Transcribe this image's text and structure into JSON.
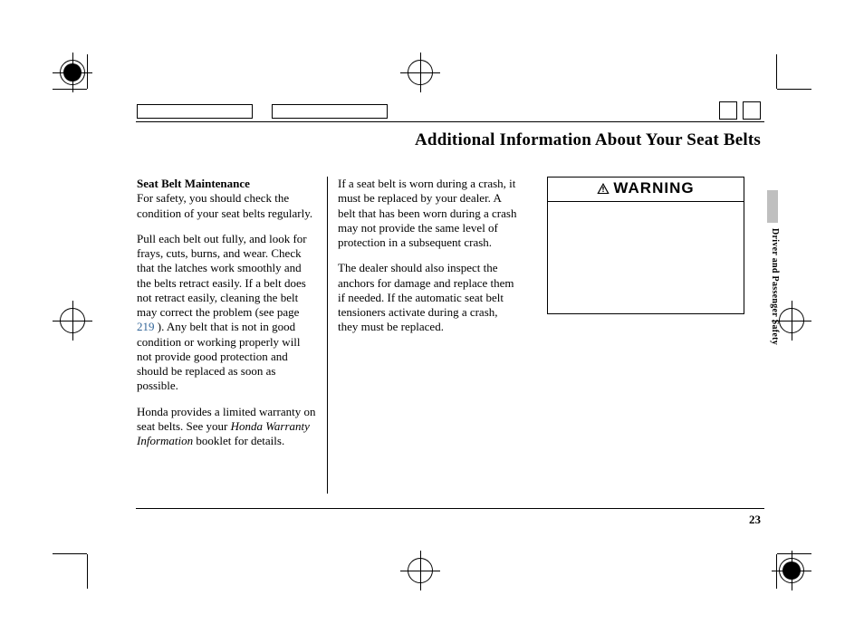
{
  "header": {
    "title": "Additional Information About Your Seat Belts"
  },
  "side_tab": {
    "label": "Driver and Passenger Safety"
  },
  "column1": {
    "heading": "Seat Belt Maintenance",
    "p1": "For safety, you should check the condition of your seat belts regularly.",
    "p2a": "Pull each belt out fully, and look for frays, cuts, burns, and wear. Check that the latches work smoothly and the belts retract easily. If a belt does not retract easily, cleaning the belt may correct the problem (see page ",
    "p2_link": "219",
    "p2b": " ). Any belt that is not in good condition or working properly will not provide good protection and should be replaced as soon as possible.",
    "p3a": "Honda provides a limited warranty on seat belts. See your ",
    "p3_italic": "Honda Warranty Information",
    "p3b": " booklet for details."
  },
  "column2": {
    "p1": "If a seat belt is worn during a crash, it must be replaced by your dealer. A belt that has been worn during a crash may not provide the same level of protection in a subsequent crash.",
    "p2": "The dealer should also inspect the anchors for damage and replace them if needed. If the automatic seat belt tensioners activate during a crash, they must be replaced."
  },
  "warning": {
    "label": "WARNING"
  },
  "footer": {
    "page_number": "23"
  }
}
